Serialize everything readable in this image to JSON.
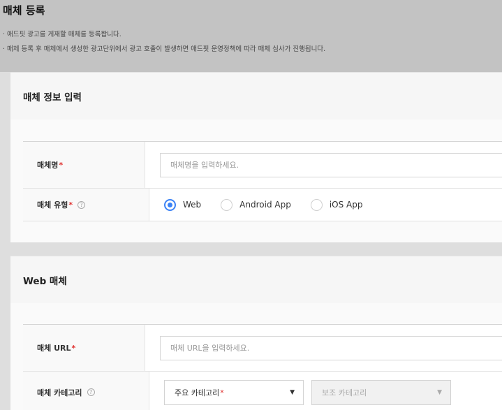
{
  "page": {
    "title": "매체 등록",
    "notices": [
      "· 애드핏 광고를 게재할 매체를 등록합니다.",
      "· 매체 등록 후 매체에서 생성한 광고단위에서 광고 호출이 발생하면 애드핏 운영정책에 따라 매체 심사가 진행됩니다."
    ]
  },
  "media_info": {
    "heading": "매체 정보 입력",
    "name_label": "매체명",
    "name_placeholder": "매체명을 입력하세요.",
    "type_label": "매체 유형",
    "required_mark": "*",
    "help_icon": "?",
    "type_options": [
      {
        "label": "Web",
        "selected": true
      },
      {
        "label": "Android App",
        "selected": false
      },
      {
        "label": "iOS App",
        "selected": false
      }
    ]
  },
  "web_media": {
    "heading": "Web 매체",
    "url_label": "매체 URL",
    "url_placeholder": "매체 URL을 입력하세요.",
    "category_label": "매체 카테고리",
    "primary_category": "주요 카테고리",
    "secondary_category": "보조 카테고리",
    "dropdown_caret": "▼"
  },
  "colors": {
    "accent": "#3b82f6",
    "required": "#e0302e"
  }
}
